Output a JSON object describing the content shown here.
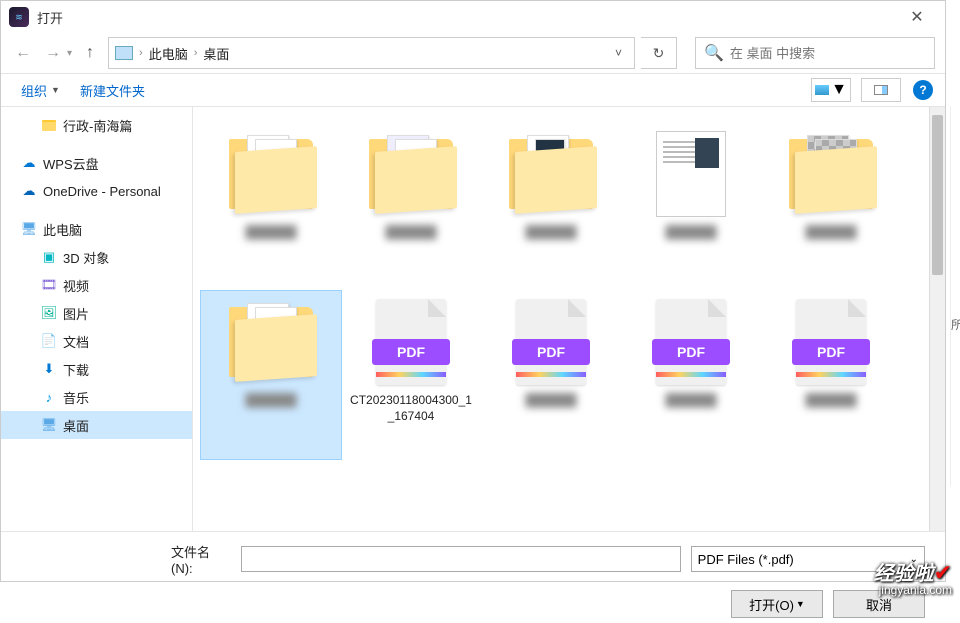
{
  "window": {
    "title": "打开"
  },
  "nav": {
    "breadcrumb": {
      "root": "此电脑",
      "leaf": "桌面"
    },
    "search_placeholder": "在 桌面 中搜索"
  },
  "toolbar": {
    "organize": "组织",
    "newfolder": "新建文件夹"
  },
  "sidebar": {
    "items": [
      {
        "label": "行政-南海篇",
        "icon": "folder",
        "indent": "child"
      },
      {
        "label": "WPS云盘",
        "icon": "cloud-blue"
      },
      {
        "label": "OneDrive - Personal",
        "icon": "cloud-dark"
      },
      {
        "label": "此电脑",
        "icon": "pc"
      },
      {
        "label": "3D 对象",
        "icon": "3d",
        "indent": "child"
      },
      {
        "label": "视频",
        "icon": "video",
        "indent": "child"
      },
      {
        "label": "图片",
        "icon": "pic",
        "indent": "child"
      },
      {
        "label": "文档",
        "icon": "doc",
        "indent": "child"
      },
      {
        "label": "下载",
        "icon": "dl",
        "indent": "child"
      },
      {
        "label": "音乐",
        "icon": "music",
        "indent": "child"
      },
      {
        "label": "桌面",
        "icon": "desk",
        "indent": "child",
        "selected": true
      }
    ]
  },
  "files": {
    "items": [
      {
        "type": "folder",
        "label": "",
        "blur": true
      },
      {
        "type": "folder-with-doc",
        "label": "",
        "blur": true
      },
      {
        "type": "folder-brochure",
        "label": "",
        "blur": true
      },
      {
        "type": "doc-preview",
        "label": "",
        "blur": true
      },
      {
        "type": "folder-photo",
        "label": "",
        "blur": true
      },
      {
        "type": "folder-word",
        "label": "",
        "blur": true,
        "selected": true
      },
      {
        "type": "pdf",
        "label": "CT20230118004300_1_167404"
      },
      {
        "type": "pdf",
        "label": ".pdf",
        "blur": true
      },
      {
        "type": "pdf",
        "label": ".pdf",
        "blur": true
      },
      {
        "type": "pdf",
        "label": ".pdf",
        "blur": true
      }
    ],
    "pdf_badge": "PDF"
  },
  "bottom": {
    "filename_label": "文件名(N):",
    "filename_value": "",
    "filter": "PDF Files (*.pdf)",
    "open": "打开(O)",
    "cancel": "取消"
  },
  "watermark": {
    "brand": "经验啦",
    "url": "jingyanla.com",
    "check": "✔"
  }
}
